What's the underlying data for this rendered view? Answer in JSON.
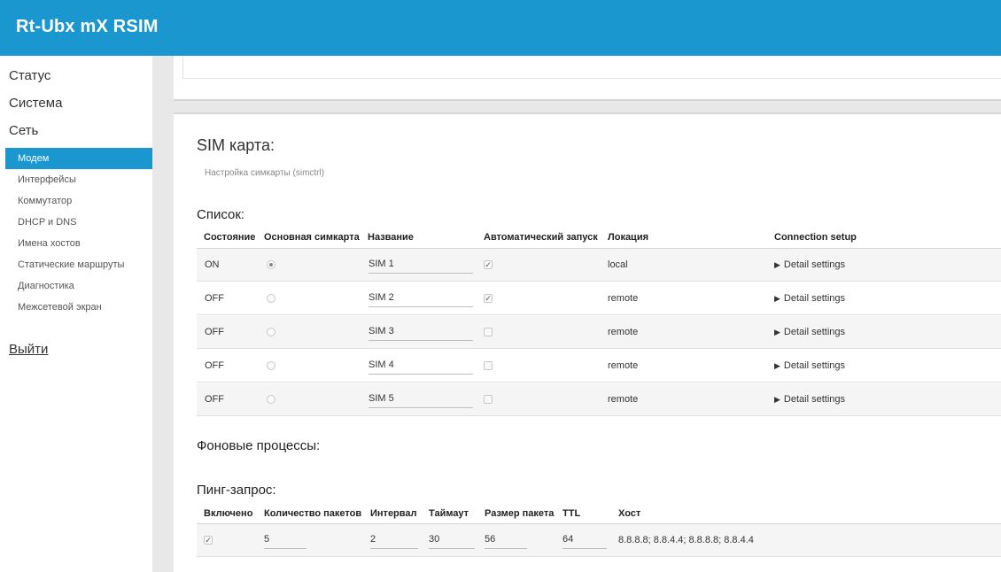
{
  "app_title": "Rt-Ubx mX RSIM",
  "sidebar": {
    "top_items": [
      {
        "label": "Статус"
      },
      {
        "label": "Система"
      },
      {
        "label": "Сеть"
      }
    ],
    "sub_items": [
      {
        "label": "Модем",
        "active": true
      },
      {
        "label": "Интерфейсы"
      },
      {
        "label": "Коммутатор"
      },
      {
        "label": "DHCP и DNS"
      },
      {
        "label": "Имена хостов"
      },
      {
        "label": "Статические маршруты"
      },
      {
        "label": "Диагностика"
      },
      {
        "label": "Межсетевой экран"
      }
    ],
    "logout": "Выйти"
  },
  "sim": {
    "title": "SIM карта:",
    "description": "Настройка симкарты (simctrl)",
    "list_heading": "Список:",
    "columns": [
      "Состояние",
      "Основная симкарта",
      "Название",
      "Автоматический запуск",
      "Локация",
      "Connection setup"
    ],
    "rows": [
      {
        "state": "ON",
        "primary": true,
        "name": "SIM 1",
        "autostart": true,
        "location": "local",
        "setup": "Detail settings"
      },
      {
        "state": "OFF",
        "primary": false,
        "name": "SIM 2",
        "autostart": true,
        "location": "remote",
        "setup": "Detail settings"
      },
      {
        "state": "OFF",
        "primary": false,
        "name": "SIM 3",
        "autostart": false,
        "location": "remote",
        "setup": "Detail settings"
      },
      {
        "state": "OFF",
        "primary": false,
        "name": "SIM 4",
        "autostart": false,
        "location": "remote",
        "setup": "Detail settings"
      },
      {
        "state": "OFF",
        "primary": false,
        "name": "SIM 5",
        "autostart": false,
        "location": "remote",
        "setup": "Detail settings"
      }
    ]
  },
  "background": {
    "heading": "Фоновые процессы:"
  },
  "ping": {
    "heading": "Пинг-запрос:",
    "columns": [
      "Включено",
      "Количество пакетов",
      "Интервал",
      "Таймаут",
      "Размер пакета",
      "TTL",
      "Хост"
    ],
    "row": {
      "enabled": true,
      "packets": "5",
      "interval": "2",
      "timeout": "30",
      "size": "56",
      "ttl": "64",
      "host": "8.8.8.8; 8.8.4.4; 8.8.8.8; 8.8.4.4"
    }
  },
  "colors": {
    "accent": "#1b97cf",
    "content_bg": "#e8e8e8"
  }
}
